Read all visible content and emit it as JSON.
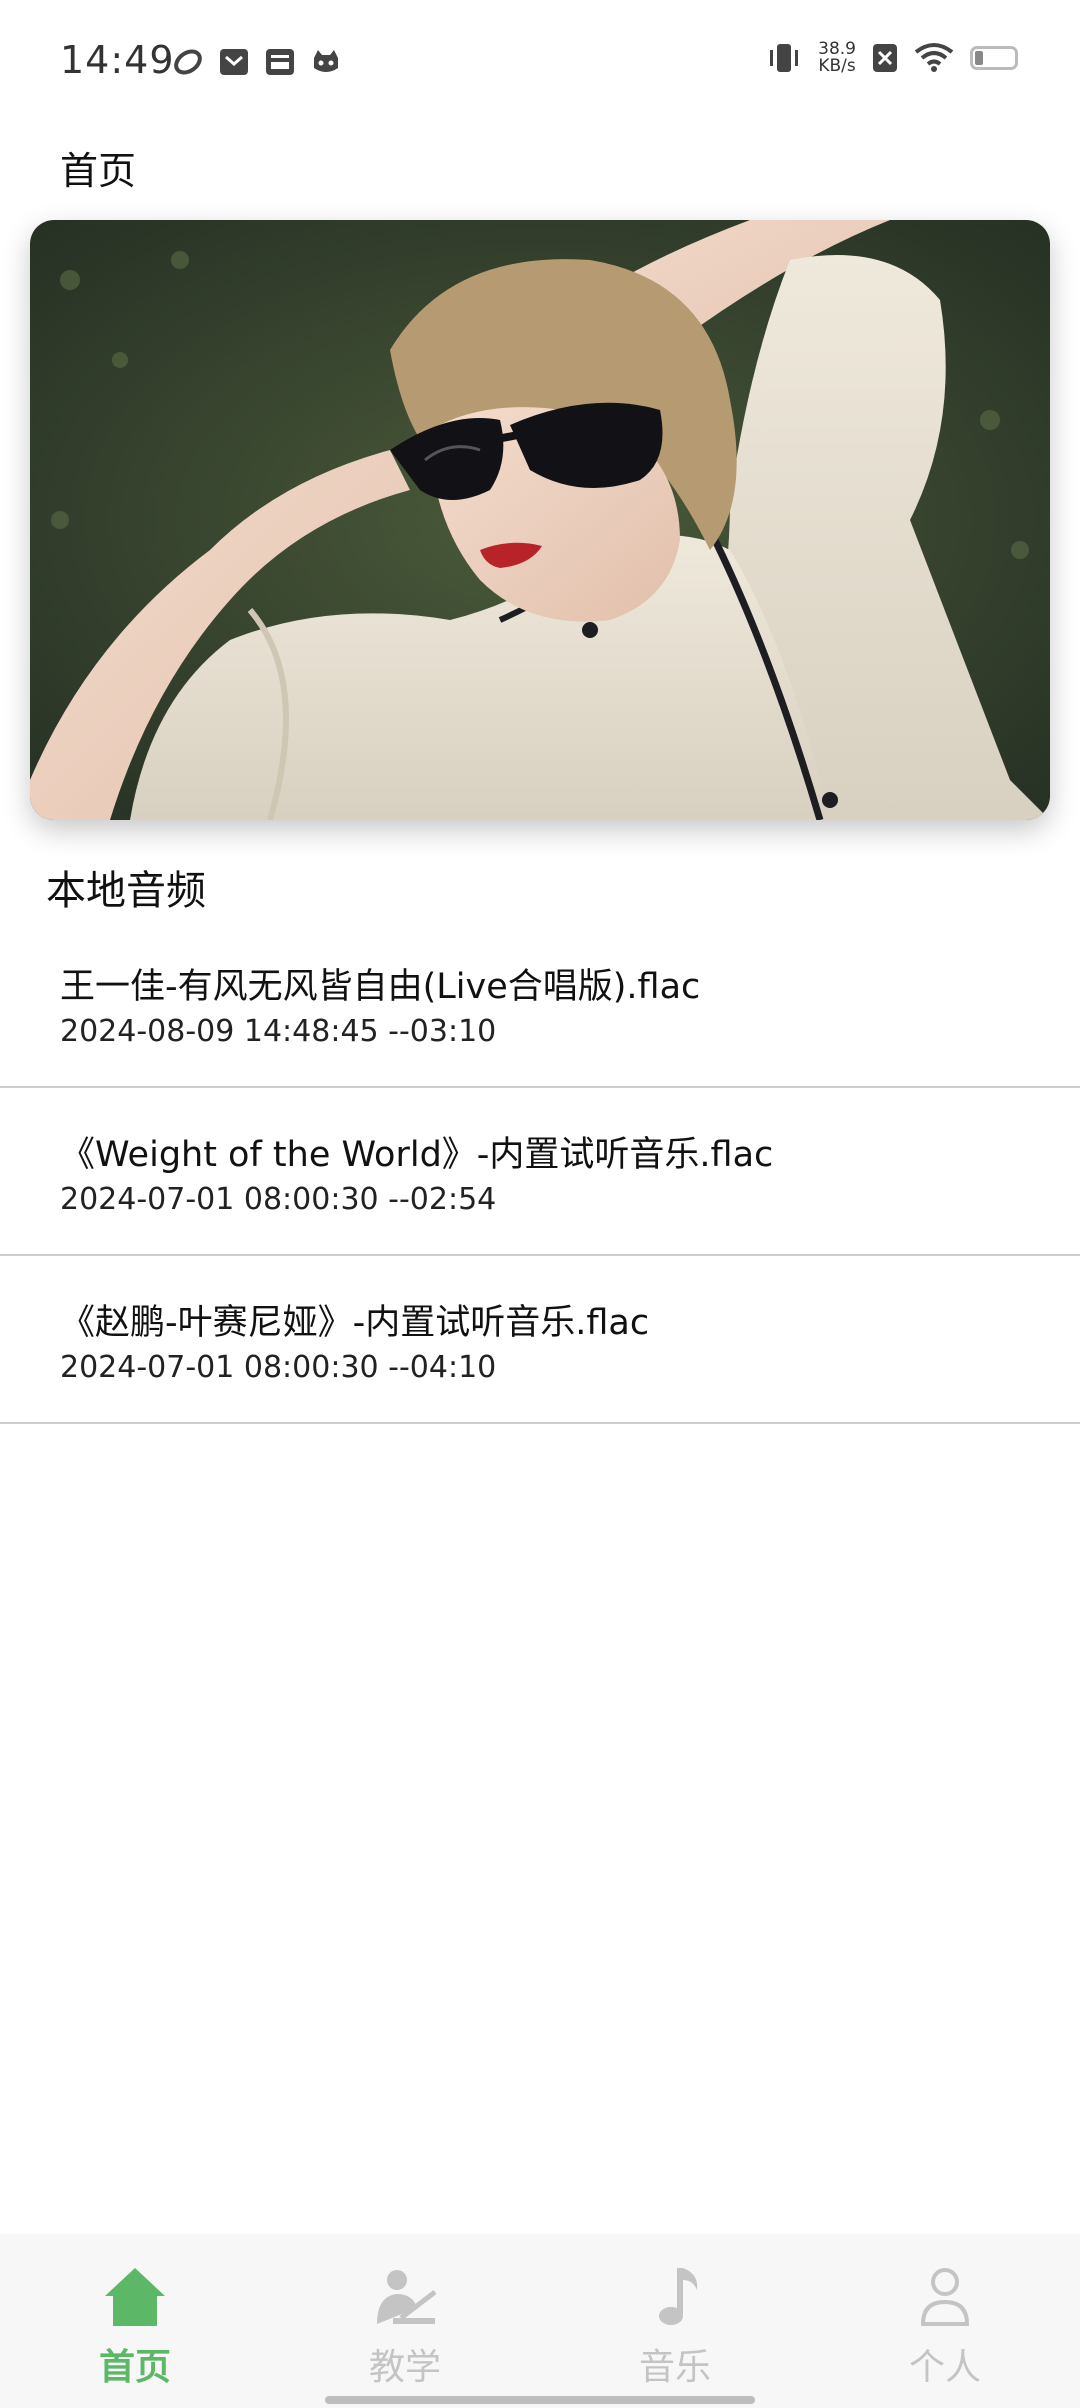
{
  "status_bar": {
    "time": "14:49",
    "net_speed_value": "38.9",
    "net_speed_unit": "KB/s",
    "icons_left": [
      "sync-icon",
      "mail-icon",
      "inbox-icon",
      "cat-app-icon"
    ],
    "icons_right": [
      "vibrate-icon",
      "no-sim-icon",
      "wifi-icon",
      "battery-icon"
    ]
  },
  "page": {
    "title": "首页"
  },
  "banner": {
    "image": "portrait-photo-woman-sunglasses-on-grass"
  },
  "section": {
    "title": "本地音频"
  },
  "audio_list": [
    {
      "title": "王一佳-有风无风皆自由(Live合唱版).flac",
      "meta": "2024-08-09 14:48:45  --03:10"
    },
    {
      "title": "《Weight of the World》-内置试听音乐.flac",
      "meta": "2024-07-01 08:00:30  --02:54"
    },
    {
      "title": "《赵鹏-叶赛尼娅》-内置试听音乐.flac",
      "meta": "2024-07-01 08:00:30  --04:10"
    }
  ],
  "bottom_nav": {
    "items": [
      {
        "label": "首页",
        "icon": "home-icon",
        "active": true
      },
      {
        "label": "教学",
        "icon": "teacher-icon",
        "active": false
      },
      {
        "label": "音乐",
        "icon": "music-note-icon",
        "active": false
      },
      {
        "label": "个人",
        "icon": "person-icon",
        "active": false
      }
    ]
  },
  "colors": {
    "accent": "#5cb866",
    "inactive": "#c4c4c4"
  }
}
